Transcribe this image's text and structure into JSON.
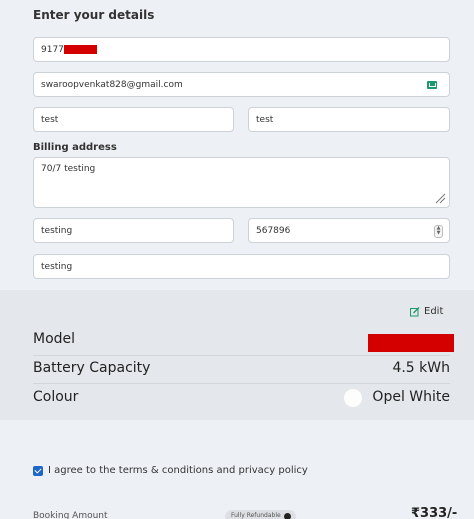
{
  "form": {
    "heading": "Enter your details",
    "phone_prefix": "9177",
    "email": "swaroopvenkat828@gmail.com",
    "first_name": "test",
    "last_name": "test",
    "billing_label": "Billing address",
    "address": "70/7 testing",
    "city": "testing",
    "pincode": "567896",
    "state": "testing"
  },
  "vehicle": {
    "edit_label": "Edit",
    "model_label": "Model",
    "battery_label": "Battery Capacity",
    "battery_value": "4.5 kWh",
    "colour_label": "Colour",
    "colour_value": "Opel White"
  },
  "checkout": {
    "terms_text": "I agree to the terms & conditions and privacy policy",
    "terms_checked": true,
    "booking_label": "Booking Amount",
    "refund_badge": "Fully Refundable",
    "price": "₹333/-"
  },
  "colors": {
    "accent": "#1e67c9",
    "edit_icon": "#1a9a6b",
    "redaction": "#d40000"
  }
}
